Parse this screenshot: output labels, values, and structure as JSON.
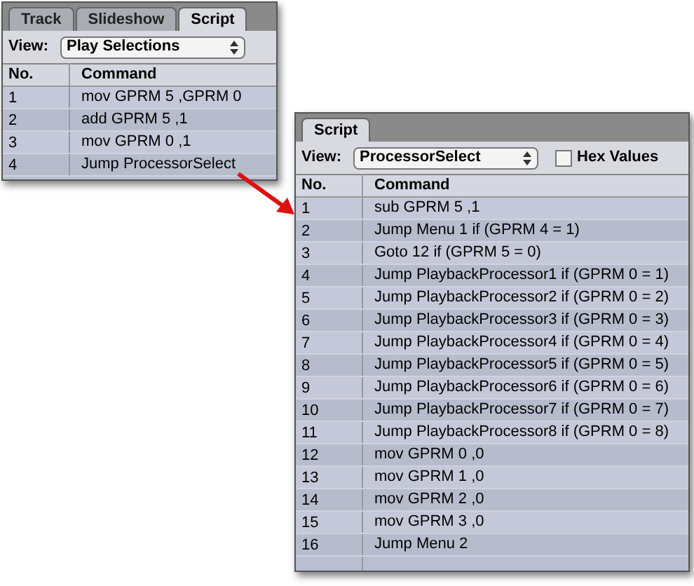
{
  "panels": [
    {
      "tabs": [
        {
          "label": "Track",
          "selected": false
        },
        {
          "label": "Slideshow",
          "selected": false
        },
        {
          "label": "Script",
          "selected": true
        }
      ],
      "view_label": "View:",
      "view_value": "Play Selections",
      "columns": [
        "No.",
        "Command"
      ],
      "rows": [
        [
          "1",
          "mov GPRM 5 ,GPRM 0"
        ],
        [
          "2",
          "add GPRM 5 ,1"
        ],
        [
          "3",
          "mov GPRM 0 ,1"
        ],
        [
          "4",
          "Jump ProcessorSelect"
        ]
      ]
    },
    {
      "tabs": [
        {
          "label": "Script",
          "selected": true
        }
      ],
      "view_label": "View:",
      "view_value": "ProcessorSelect",
      "hex_values": {
        "label": "Hex Values",
        "checked": false
      },
      "columns": [
        "No.",
        "Command"
      ],
      "rows": [
        [
          "1",
          "sub GPRM 5 ,1"
        ],
        [
          "2",
          "Jump Menu 1 if (GPRM 4 = 1)"
        ],
        [
          "3",
          "Goto 12 if (GPRM 5 = 0)"
        ],
        [
          "4",
          "Jump PlaybackProcessor1 if (GPRM 0 = 1)"
        ],
        [
          "5",
          "Jump PlaybackProcessor2 if (GPRM 0 = 2)"
        ],
        [
          "6",
          "Jump PlaybackProcessor3 if (GPRM 0 = 3)"
        ],
        [
          "7",
          "Jump PlaybackProcessor4 if (GPRM 0 = 4)"
        ],
        [
          "8",
          "Jump PlaybackProcessor5 if (GPRM 0 = 5)"
        ],
        [
          "9",
          "Jump PlaybackProcessor6 if (GPRM 0 = 6)"
        ],
        [
          "10",
          "Jump PlaybackProcessor7 if (GPRM 0 = 7)"
        ],
        [
          "11",
          "Jump PlaybackProcessor8 if (GPRM 0 = 8)"
        ],
        [
          "12",
          "mov GPRM 0 ,0"
        ],
        [
          "13",
          "mov GPRM 1 ,0"
        ],
        [
          "14",
          "mov GPRM 2 ,0"
        ],
        [
          "15",
          "mov GPRM 3 ,0"
        ],
        [
          "16",
          "Jump Menu 2"
        ]
      ]
    }
  ]
}
